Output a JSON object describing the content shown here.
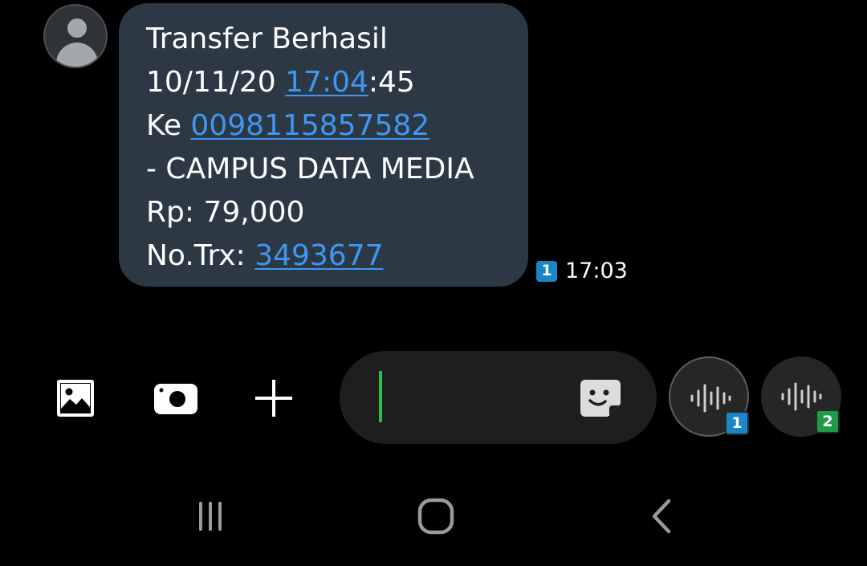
{
  "message": {
    "title": "Transfer Berhasil",
    "date": "10/11/20",
    "time_link": "17:04",
    "time_suffix": ":45",
    "to_label": "Ke",
    "account_number": "0098115857582",
    "recipient": "- CAMPUS DATA MEDIA",
    "amount": "Rp: 79,000",
    "trx_label": "No.Trx:",
    "trx_number": "3493677",
    "sim": "1",
    "received_time": "17:03",
    "link_color": "#3e97f2",
    "bubble_color": "#2c3843"
  },
  "input_bar": {
    "gallery_icon": "gallery-icon",
    "camera_icon": "camera-icon",
    "add_icon": "plus-icon",
    "compose_value": "",
    "sticker_icon": "sticker-icon",
    "voice_sim1_label": "1",
    "voice_sim2_label": "2",
    "cursor_color": "#26c244"
  },
  "nav": {
    "recents_icon": "recents-icon",
    "home_icon": "home-icon",
    "back_icon": "back-icon"
  }
}
